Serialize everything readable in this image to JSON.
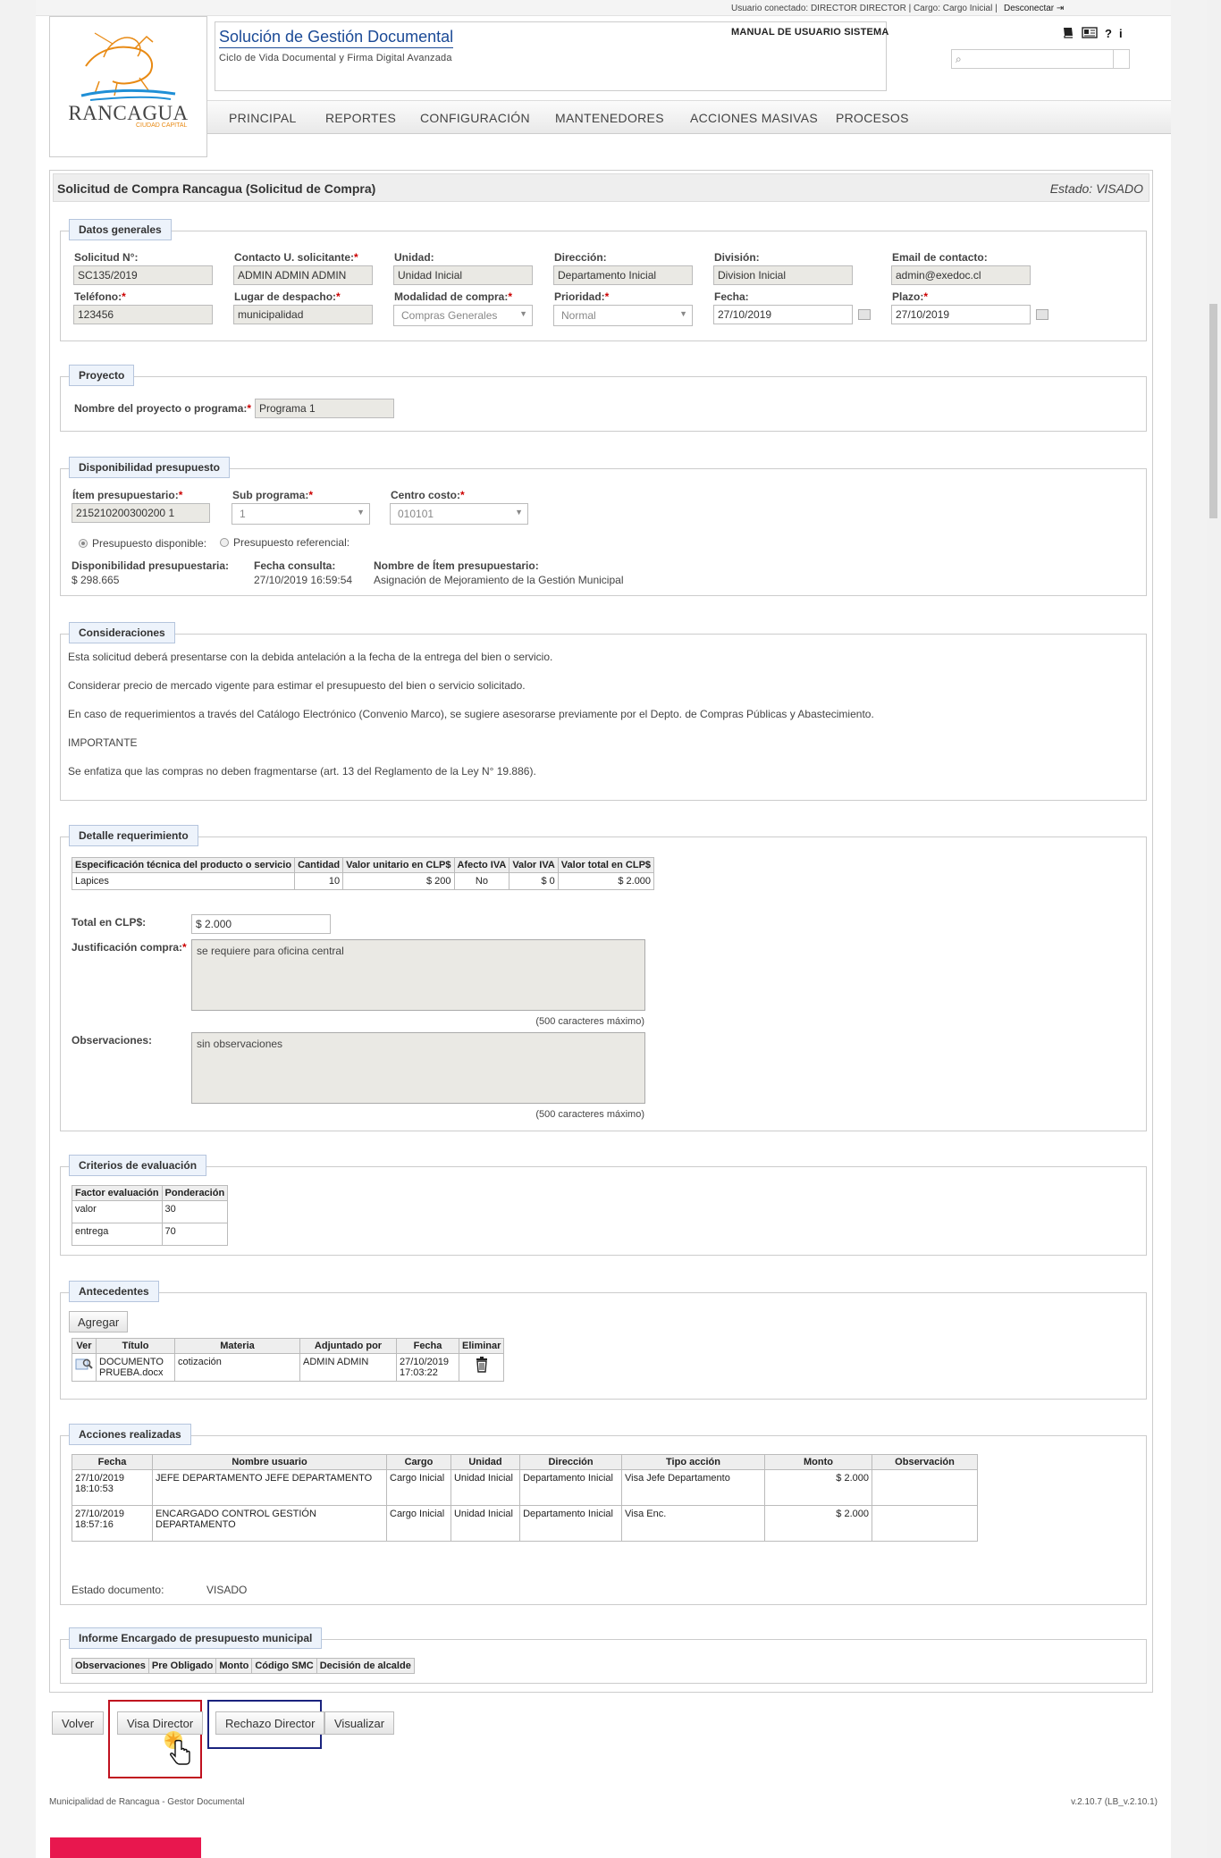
{
  "topbar": {
    "user_info": "Usuario conectado: DIRECTOR DIRECTOR | Cargo: Cargo Inicial |",
    "logout": "Desconectar"
  },
  "logo": {
    "name": "RANCAGUA",
    "subtitle": "CIUDAD CAPITAL"
  },
  "app": {
    "title": "Solución de Gestión Documental",
    "subtitle": "Ciclo de Vida Documental y Firma Digital Avanzada",
    "manual": "MANUAL DE USUARIO SISTEMA"
  },
  "toolbar_icons": [
    "book-icon",
    "id-card-icon",
    "help-icon",
    "info-icon"
  ],
  "toolbar_glyphs": {
    "help": "?",
    "info": "i"
  },
  "search": {
    "placeholder": ""
  },
  "nav": [
    "PRINCIPAL",
    "REPORTES",
    "CONFIGURACIÓN",
    "MANTENEDORES",
    "ACCIONES MASIVAS",
    "PROCESOS"
  ],
  "header": {
    "title": "Solicitud de Compra Rancagua (Solicitud de Compra)",
    "estado": "Estado: VISADO"
  },
  "datos": {
    "legend": "Datos generales",
    "solicitud_label": "Solicitud N°:",
    "solicitud": "SC135/2019",
    "contacto_label": "Contacto U. solicitante:",
    "contacto": "ADMIN ADMIN ADMIN",
    "unidad_label": "Unidad:",
    "unidad": "Unidad Inicial",
    "direccion_label": "Dirección:",
    "direccion": "Departamento Inicial",
    "division_label": "División:",
    "division": "Division Inicial",
    "email_label": "Email de contacto:",
    "email": "admin@exedoc.cl",
    "telefono_label": "Teléfono:",
    "telefono": "123456",
    "lugar_label": "Lugar de despacho:",
    "lugar": "municipalidad",
    "modalidad_label": "Modalidad de compra:",
    "modalidad": "Compras Generales",
    "prioridad_label": "Prioridad:",
    "prioridad": "Normal",
    "fecha_label": "Fecha:",
    "fecha": "27/10/2019",
    "plazo_label": "Plazo:",
    "plazo": "27/10/2019"
  },
  "proyecto": {
    "legend": "Proyecto",
    "nombre_label": "Nombre del proyecto o programa:",
    "nombre": "Programa 1"
  },
  "presupuesto": {
    "legend": "Disponibilidad presupuesto",
    "item_label": "Ítem presupuestario:",
    "item": "215210200300200 1",
    "subprograma_label": "Sub programa:",
    "subprograma": "1",
    "centro_label": "Centro costo:",
    "centro": "010101",
    "radio_disponible": "Presupuesto disponible:",
    "radio_referencial": "Presupuesto referencial:",
    "disponibilidad_label": "Disponibilidad presupuestaria:",
    "disponibilidad": "$ 298.665",
    "fecha_consulta_label": "Fecha consulta:",
    "fecha_consulta": "27/10/2019 16:59:54",
    "nombre_item_label": "Nombre de Ítem presupuestario:",
    "nombre_item": "Asignación de Mejoramiento de la Gestión Municipal"
  },
  "consideraciones": {
    "legend": "Consideraciones",
    "lines": [
      "Esta solicitud deberá presentarse con la debida antelación a la fecha de la entrega del bien o servicio.",
      "Considerar precio de mercado vigente para estimar el presupuesto del bien o servicio solicitado.",
      "En caso de requerimientos a través del Catálogo Electrónico (Convenio Marco), se sugiere asesorarse previamente por el Depto. de Compras Públicas y Abastecimiento.",
      "IMPORTANTE",
      "Se enfatiza que las compras no deben fragmentarse (art. 13 del Reglamento de la Ley N° 19.886)."
    ]
  },
  "detalle": {
    "legend": "Detalle requerimiento",
    "headers": [
      "Especificación técnica del producto o servicio",
      "Cantidad",
      "Valor unitario en CLP$",
      "Afecto IVA",
      "Valor IVA",
      "Valor total en CLP$"
    ],
    "rows": [
      [
        "Lapices",
        "10",
        "$ 200",
        "No",
        "$ 0",
        "$ 2.000"
      ]
    ],
    "total_label": "Total en CLP$:",
    "total": "$ 2.000",
    "justificacion_label": "Justificación compra:",
    "justificacion": "se requiere para oficina central",
    "max1": "(500 caracteres máximo)",
    "observaciones_label": "Observaciones:",
    "observaciones": "sin observaciones",
    "max2": "(500 caracteres máximo)"
  },
  "criterios": {
    "legend": "Criterios de evaluación",
    "headers": [
      "Factor evaluación",
      "Ponderación"
    ],
    "rows": [
      [
        "valor",
        "30"
      ],
      [
        "entrega",
        "70"
      ]
    ]
  },
  "antecedentes": {
    "legend": "Antecedentes",
    "add_button": "Agregar",
    "headers": [
      "Ver",
      "Título",
      "Materia",
      "Adjuntado por",
      "Fecha",
      "Eliminar"
    ],
    "rows": [
      [
        "",
        "DOCUMENTO PRUEBA.docx",
        "cotización",
        "ADMIN ADMIN",
        "27/10/2019 17:03:22",
        ""
      ]
    ]
  },
  "acciones": {
    "legend": "Acciones realizadas",
    "headers": [
      "Fecha",
      "Nombre usuario",
      "Cargo",
      "Unidad",
      "Dirección",
      "Tipo acción",
      "Monto",
      "Observación"
    ],
    "rows": [
      [
        "27/10/2019 18:10:53",
        "JEFE DEPARTAMENTO JEFE DEPARTAMENTO",
        "Cargo Inicial",
        "Unidad Inicial",
        "Departamento Inicial",
        "Visa Jefe Departamento",
        "$ 2.000",
        ""
      ],
      [
        "27/10/2019 18:57:16",
        "ENCARGADO CONTROL GESTIÓN DEPARTAMENTO",
        "Cargo Inicial",
        "Unidad Inicial",
        "Departamento Inicial",
        "Visa Enc.",
        "$ 2.000",
        ""
      ]
    ],
    "estado_label": "Estado documento:",
    "estado": "VISADO"
  },
  "informe": {
    "legend": "Informe Encargado de presupuesto municipal",
    "headers": [
      "Observaciones",
      "Pre Obligado",
      "Monto",
      "Código SMC",
      "Decisión de alcalde"
    ]
  },
  "buttons": {
    "volver": "Volver",
    "visa": "Visa Director",
    "rechazo": "Rechazo Director",
    "visualizar": "Visualizar"
  },
  "footer": {
    "left": "Municipalidad de Rancagua - Gestor Documental",
    "right": "v.2.10.7 (LB_v.2.10.1)"
  },
  "colors": {
    "title_blue": "#1b4a96",
    "logo_orange": "#e88a14",
    "highlight_red": "#c0111f",
    "highlight_navy": "#1a237e",
    "brand_red": "#e8174e"
  }
}
